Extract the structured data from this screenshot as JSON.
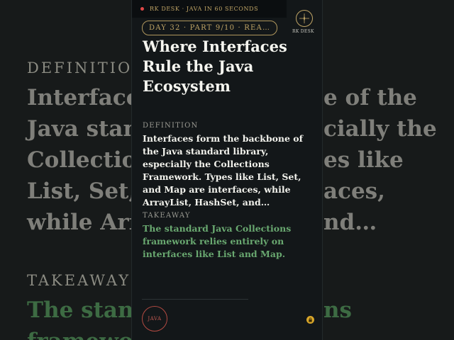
{
  "background": {
    "definition_label": "DEFINITION",
    "definition_lines": [
      "Interfaces",
      "Java stand",
      "Collection",
      "List, Set, a",
      "while Arra"
    ],
    "definition_right": [
      "e of the",
      "cially the",
      "es like",
      "aces,",
      "nd…"
    ],
    "takeaway_label": "TAKEAWAY",
    "takeaway_left": "The stand",
    "takeaway_right": "ns",
    "takeaway_cut": "framewo"
  },
  "topbar": {
    "text": "RK DESK · JAVA IN 60 SECONDS"
  },
  "badge": {
    "label": "RK DESK"
  },
  "pill": {
    "text": "DAY 32 · PART 9/10 · REA…"
  },
  "title": "Where Interfaces Rule the Java Ecosystem",
  "definition": {
    "label": "DEFINITION",
    "text": "Interfaces form the backbone of the Java standard library, especially the Collections Framework. Types like List, Set, and Map are interfaces, while ArrayList, HashSet, and…"
  },
  "takeaway": {
    "label": "TAKEAWAY",
    "text": "The standard Java Collections framework relies entirely on interfaces like List and Map."
  },
  "java_button": {
    "label": "JAVA"
  },
  "colors": {
    "gold": "#c0a566",
    "green": "#69a870",
    "red": "#b24a42",
    "lock": "#d8a62a"
  }
}
